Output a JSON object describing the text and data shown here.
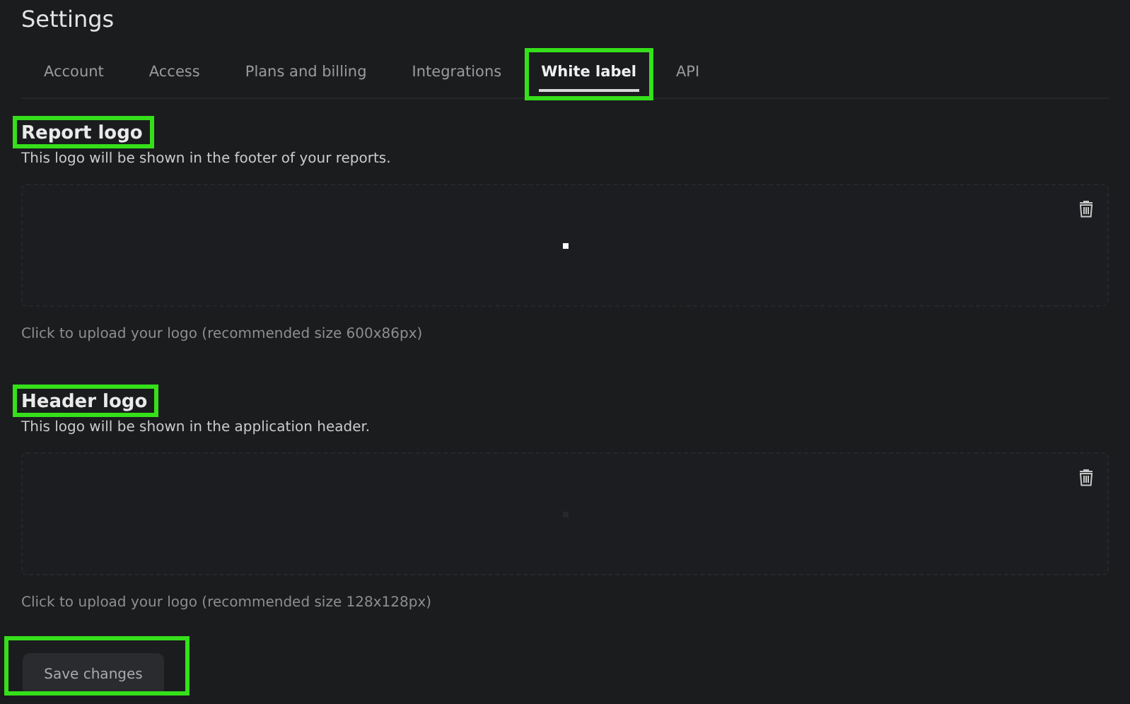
{
  "title": "Settings",
  "tabs": [
    {
      "label": "Account",
      "selected": false,
      "highlighted": false
    },
    {
      "label": "Access",
      "selected": false,
      "highlighted": false
    },
    {
      "label": "Plans and billing",
      "selected": false,
      "highlighted": false
    },
    {
      "label": "Integrations",
      "selected": false,
      "highlighted": false
    },
    {
      "label": "White label",
      "selected": true,
      "highlighted": true
    },
    {
      "label": "API",
      "selected": false,
      "highlighted": false
    }
  ],
  "sections": [
    {
      "heading": "Report logo",
      "highlighted": true,
      "description": "This logo will be shown in the footer of your reports.",
      "has_logo": true,
      "hint": "Click to upload your logo (recommended size 600x86px)"
    },
    {
      "heading": "Header logo",
      "highlighted": true,
      "description": "This logo will be shown in the application header.",
      "has_logo": false,
      "hint": "Click to upload your logo (recommended size 128x128px)"
    }
  ],
  "save_button": {
    "label": "Save changes",
    "highlighted": true
  }
}
